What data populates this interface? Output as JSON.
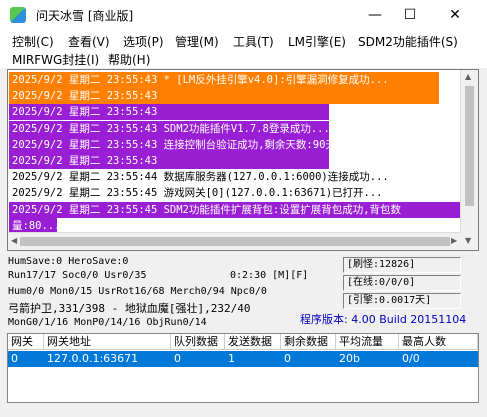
{
  "window": {
    "title": "问天冰雪 [商业版]",
    "minimize": "—",
    "maximize": "☐",
    "close": "✕"
  },
  "menu": [
    "控制(C)",
    "查看(V)",
    "选项(P)",
    "管理(M)",
    "工具(T)",
    "LM引擎(E)",
    "SDM2功能插件(S)",
    "MIRFWG封挂(I)",
    "帮助(H)"
  ],
  "log": [
    {
      "text": "2025/9/2 星期二 23:55:43 * [LM反外挂引擎v4.0]:引擎漏洞修复成功...",
      "bg": "#ff7f00",
      "fg": "#ffffff"
    },
    {
      "text": "2025/9/2 星期二 23:55:43",
      "bg": "#ff7f00",
      "fg": "#ffffff"
    },
    {
      "text": "2025/9/2 星期二 23:55:43",
      "bg": "#9a1fd4",
      "fg": "#ffffff"
    },
    {
      "text": "2025/9/2 星期二 23:55:43 SDM2功能插件V1.7.8登录成功...",
      "bg": "#9a1fd4",
      "fg": "#ffffff"
    },
    {
      "text": "2025/9/2 星期二 23:55:43 连接控制台验证成功,剩余天数:90天",
      "bg": "#9a1fd4",
      "fg": "#ffffff"
    },
    {
      "text": "2025/9/2 星期二 23:55:43",
      "bg": "#9a1fd4",
      "fg": "#ffffff"
    },
    {
      "text": "2025/9/2 星期二 23:55:44 数据库服务器(127.0.0.1:6000)连接成功...",
      "bg": "#ffffff",
      "fg": "#000000"
    },
    {
      "text": "2025/9/2 星期二 23:55:45 游戏网关[0](127.0.0.1:63671)已打开...",
      "bg": "#ffffff",
      "fg": "#000000"
    },
    {
      "text": "2025/9/2 星期二 23:55:45 SDM2功能插件扩展背包:设置扩展背包成功,背包数",
      "bg": "#9a1fd4",
      "fg": "#ffffff"
    },
    {
      "text": "量:80...",
      "bg": "#9a1fd4",
      "fg": "#ffffff"
    }
  ],
  "status": {
    "line1": "HumSave:0 HeroSave:0",
    "line2": "Run17/17 Soc0/0 Usr0/35",
    "timer": "0:2:30 [M][F]",
    "line3": "Hum0/0 Mon0/15 UsrRot16/68 Merch0/94 Npc0/0",
    "line4": "弓箭护卫,331/398 - 地狱血魔[强壮],232/40",
    "line5": "MonG0/1/16 MonP0/14/16 ObjRun0/14",
    "refresh": "[刷怪:12826]",
    "online": "[在线:0/0/0]",
    "mob_rate": "[引擎:0.0017天]",
    "version": "程序版本: 4.00 Build 20151104"
  },
  "grid": {
    "columns": [
      "网关",
      "网关地址",
      "队列数据",
      "发送数据",
      "剩余数据",
      "平均流量",
      "最高人数"
    ],
    "rows": [
      [
        "0",
        "127.0.0.1:63671",
        "0",
        "1",
        "0",
        "20b",
        "0/0"
      ]
    ]
  },
  "colors": {
    "orange": "#ff7f00",
    "purple": "#9a1fd4",
    "selection": "#0078d7",
    "version_text": "#0000c0"
  }
}
